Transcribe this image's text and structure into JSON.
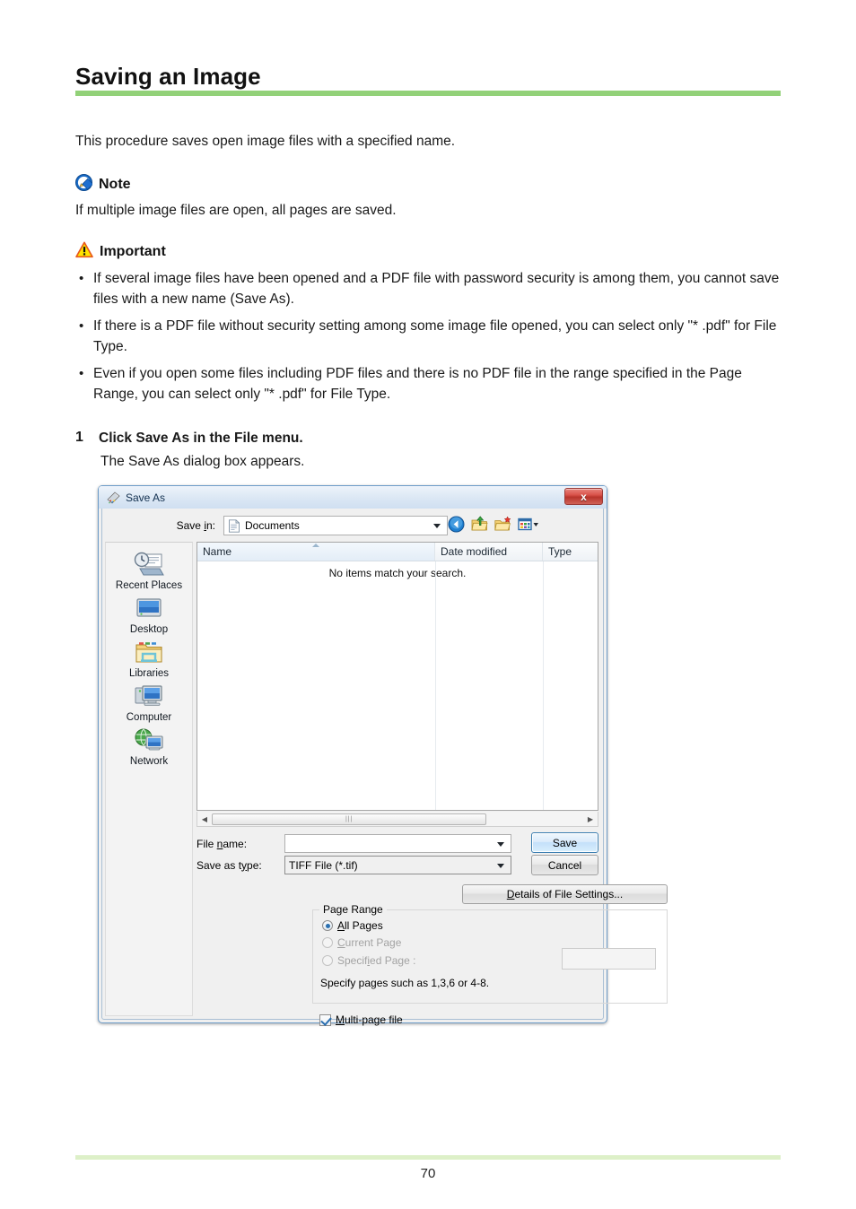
{
  "document": {
    "title": "Saving an Image",
    "intro": "This procedure saves open image files with a specified name.",
    "page_number": "70",
    "rule_color": "#92d178",
    "footer_rule_color": "#ddf0c8"
  },
  "note": {
    "icon": "note-icon",
    "heading": "Note",
    "body": "If multiple image files are open, all pages are saved."
  },
  "important": {
    "icon": "warning-triangle-icon",
    "heading": "Important",
    "bullets": [
      "If several image files have been opened and a PDF file with password security is among them, you cannot save files with a new name (Save As).",
      "If there is a PDF file without security setting among some image file opened, you can select only \"* .pdf\" for File Type.",
      "Even if you open some files including PDF files and there is no PDF file in the range specified in the Page Range, you can select only \"* .pdf\" for File Type."
    ]
  },
  "step": {
    "number": "1",
    "title": "Click Save As in the File menu.",
    "description": "The Save As dialog box appears."
  },
  "dialog": {
    "title": "Save As",
    "close_label": "x",
    "savein": {
      "label": "Save in:",
      "value": "Documents"
    },
    "toolbar_icons": [
      "back-icon",
      "up-folder-icon",
      "new-folder-icon",
      "views-icon"
    ],
    "places": [
      {
        "label": "Recent Places",
        "icon": "recent-places-icon"
      },
      {
        "label": "Desktop",
        "icon": "desktop-icon"
      },
      {
        "label": "Libraries",
        "icon": "libraries-icon"
      },
      {
        "label": "Computer",
        "icon": "computer-icon"
      },
      {
        "label": "Network",
        "icon": "network-icon"
      }
    ],
    "filelist": {
      "columns": [
        "Name",
        "Date modified",
        "Type"
      ],
      "sorted_column": "Name",
      "sort_direction": "ascending",
      "empty_message": "No items match your search.",
      "rows": []
    },
    "filename": {
      "label": "File name:",
      "value": "",
      "placeholder": ""
    },
    "filetype": {
      "label": "Save as type:",
      "value": "TIFF File (*.tif)"
    },
    "buttons": {
      "save": "Save",
      "cancel": "Cancel",
      "details": "Details of File Settings..."
    },
    "page_range": {
      "title": "Page Range",
      "options": [
        {
          "label": "All Pages",
          "selected": true,
          "enabled": true
        },
        {
          "label": "Current Page",
          "selected": false,
          "enabled": false
        },
        {
          "label": "Specified Page :",
          "selected": false,
          "enabled": false
        }
      ],
      "specified_value": "",
      "hint": "Specify pages such as 1,3,6 or 4-8."
    },
    "multipage": {
      "label": "Multi-page file",
      "checked": true
    }
  }
}
